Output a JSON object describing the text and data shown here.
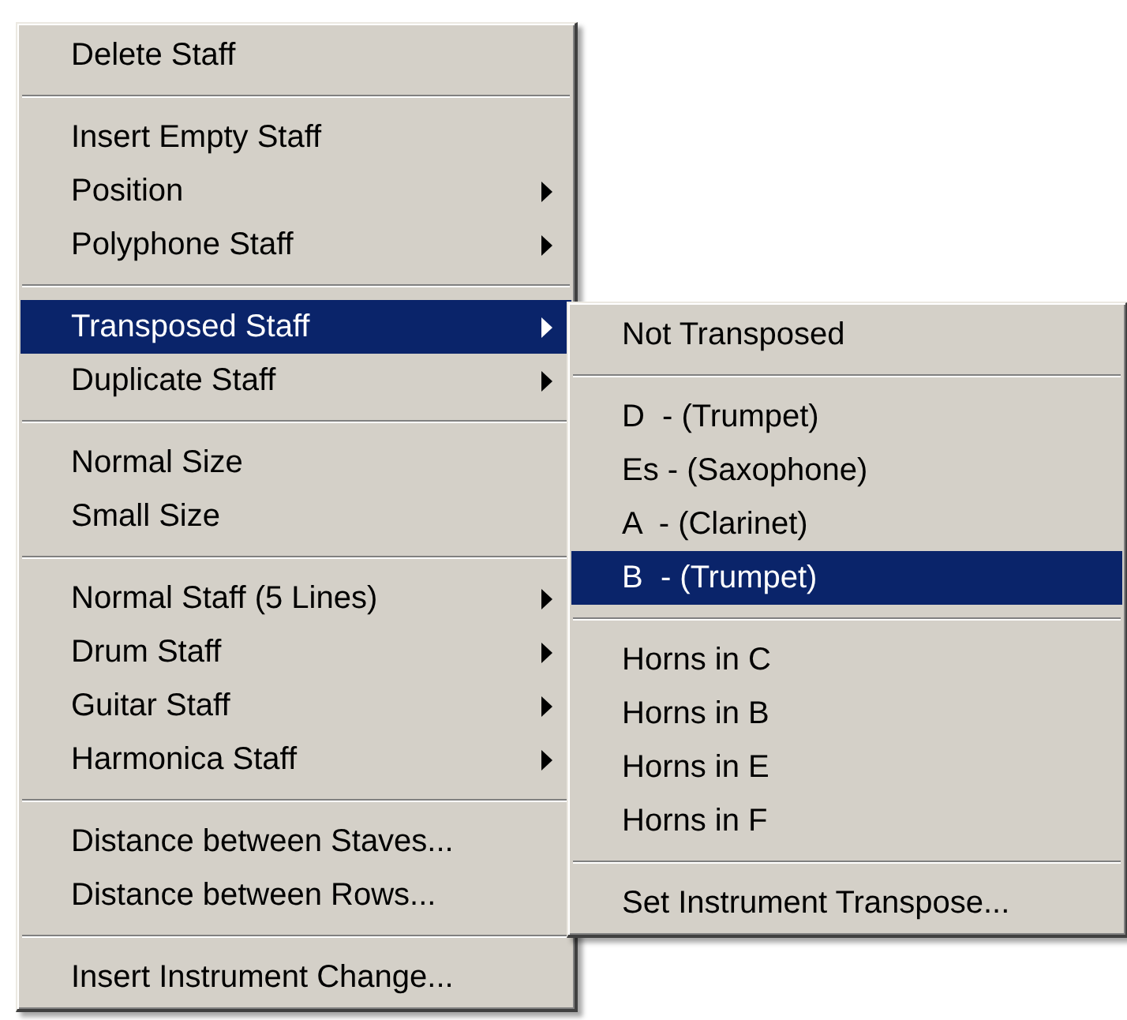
{
  "menu": {
    "sections": [
      {
        "items": [
          {
            "label": "Delete Staff",
            "has_submenu": false,
            "selected": false
          }
        ]
      },
      {
        "items": [
          {
            "label": "Insert Empty Staff",
            "has_submenu": false,
            "selected": false
          },
          {
            "label": "Position",
            "has_submenu": true,
            "selected": false
          },
          {
            "label": "Polyphone Staff",
            "has_submenu": true,
            "selected": false
          }
        ]
      },
      {
        "items": [
          {
            "label": "Transposed Staff",
            "has_submenu": true,
            "selected": true
          },
          {
            "label": "Duplicate Staff",
            "has_submenu": true,
            "selected": false
          }
        ]
      },
      {
        "items": [
          {
            "label": "Normal Size",
            "has_submenu": false,
            "selected": false
          },
          {
            "label": "Small Size",
            "has_submenu": false,
            "selected": false
          }
        ]
      },
      {
        "items": [
          {
            "label": "Normal Staff (5 Lines)",
            "has_submenu": true,
            "selected": false
          },
          {
            "label": "Drum Staff",
            "has_submenu": true,
            "selected": false
          },
          {
            "label": "Guitar Staff",
            "has_submenu": true,
            "selected": false
          },
          {
            "label": "Harmonica Staff",
            "has_submenu": true,
            "selected": false
          }
        ]
      },
      {
        "items": [
          {
            "label": "Distance between Staves...",
            "has_submenu": false,
            "selected": false
          },
          {
            "label": "Distance between Rows...",
            "has_submenu": false,
            "selected": false
          }
        ]
      },
      {
        "items": [
          {
            "label": "Insert Instrument Change...",
            "has_submenu": false,
            "selected": false
          }
        ]
      }
    ]
  },
  "submenu": {
    "sections": [
      {
        "items": [
          {
            "label": "Not Transposed",
            "has_submenu": false,
            "selected": false
          }
        ]
      },
      {
        "items": [
          {
            "label": "D  - (Trumpet)",
            "has_submenu": false,
            "selected": false
          },
          {
            "label": "Es - (Saxophone)",
            "has_submenu": false,
            "selected": false
          },
          {
            "label": "A  - (Clarinet)",
            "has_submenu": false,
            "selected": false
          },
          {
            "label": "B  - (Trumpet)",
            "has_submenu": false,
            "selected": true
          }
        ]
      },
      {
        "items": [
          {
            "label": "Horns in C",
            "has_submenu": false,
            "selected": false
          },
          {
            "label": "Horns in B",
            "has_submenu": false,
            "selected": false
          },
          {
            "label": "Horns in E",
            "has_submenu": false,
            "selected": false
          },
          {
            "label": "Horns in F",
            "has_submenu": false,
            "selected": false
          }
        ]
      },
      {
        "items": [
          {
            "label": "Set Instrument Transpose...",
            "has_submenu": false,
            "selected": false
          }
        ]
      }
    ]
  }
}
